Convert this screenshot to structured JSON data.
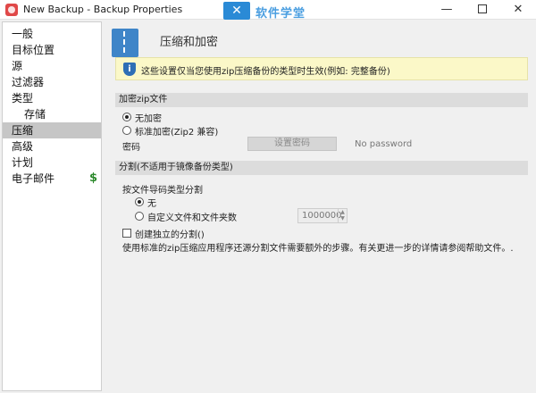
{
  "window": {
    "title": "New Backup - Backup Properties",
    "watermark": "软件学堂",
    "minimize_glyph": "—",
    "close_glyph": "✕"
  },
  "sidebar": {
    "items": [
      {
        "label": "一般"
      },
      {
        "label": "目标位置"
      },
      {
        "label": "源"
      },
      {
        "label": "过滤器"
      },
      {
        "label": "类型"
      },
      {
        "label": "存储"
      },
      {
        "label": "压缩"
      },
      {
        "label": "高级"
      },
      {
        "label": "计划"
      },
      {
        "label": "电子邮件",
        "badge": "$"
      }
    ],
    "selected": "压缩"
  },
  "section": {
    "title": "压缩和加密",
    "icon": "zip-archive-icon",
    "info_icon": "shield-info-icon",
    "info": "这些设置仅当您使用zip压缩备份的类型时生效(例如: 完整备份)"
  },
  "encryption": {
    "header": "加密zip文件",
    "option_none": "无加密",
    "option_standard": "标准加密(Zip2 兼容)",
    "password_label": "密码",
    "set_password_button": "设置密码",
    "password_status": "No password"
  },
  "split": {
    "header": "分割(不适用于镜像备份类型)",
    "label": "按文件导码类型分割",
    "option_none": "无",
    "option_custom": "自定义文件和文件夹数",
    "custom_value": "1000000",
    "separate_split_label": "创建独立的分割()",
    "note": "使用标准的zip压缩应用程序还源分割文件需要额外的步骤。有关更进一步的详情请参阅帮助文件。."
  },
  "colors": {
    "info_background": "#fbf8c8",
    "selected_nav": "#c6c6c6",
    "accent_blue": "#3f85c8",
    "badge_green": "#2d8a2d"
  }
}
